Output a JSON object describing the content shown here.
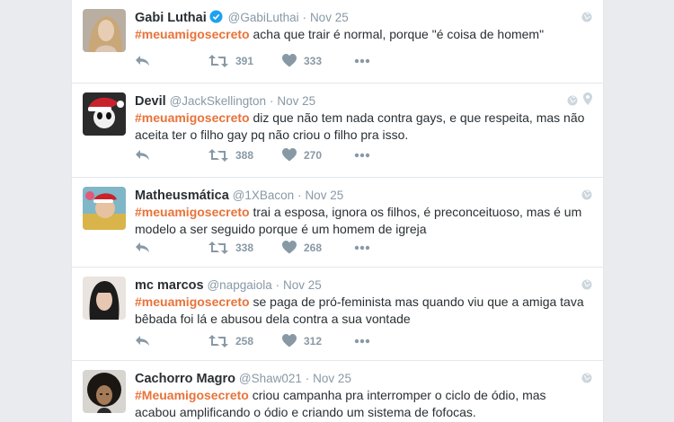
{
  "colors": {
    "hashtag": "#e8733a",
    "text": "#292f33",
    "secondary": "#8899a6",
    "verified": "#1da1f2"
  },
  "tweets": [
    {
      "name": "Gabi Luthai",
      "verified": true,
      "handle": "@GabiLuthai",
      "sep": "·",
      "date": "Nov 25",
      "hashtag": "#meuamigosecreto",
      "text": " acha que trair é normal, porque \"é coisa de homem\"",
      "retweets": "391",
      "likes": "333",
      "icons": [
        "reply-icon",
        "retweet-icon",
        "heart-icon",
        "more-icon",
        "globe-icon"
      ]
    },
    {
      "name": "Devil",
      "verified": false,
      "handle": "@JackSkellington",
      "sep": "·",
      "date": "Nov 25",
      "hashtag": "#meuamigosecreto",
      "text": " diz que não tem nada contra gays, e que respeita, mas não aceita ter o filho gay pq não criou o filho pra isso.",
      "retweets": "388",
      "likes": "270",
      "icons": [
        "reply-icon",
        "retweet-icon",
        "heart-icon",
        "more-icon",
        "globe-icon",
        "location-pin-icon"
      ]
    },
    {
      "name": "Matheusmática",
      "verified": false,
      "handle": "@1XBacon",
      "sep": "·",
      "date": "Nov 25",
      "hashtag": "#meuamigosecreto",
      "text": " trai a esposa, ignora os filhos, é preconceituoso, mas é um modelo a ser seguido porque é um homem de igreja",
      "retweets": "338",
      "likes": "268",
      "icons": [
        "reply-icon",
        "retweet-icon",
        "heart-icon",
        "more-icon",
        "globe-icon"
      ]
    },
    {
      "name": "mc marcos",
      "verified": false,
      "handle": "@napgaiola",
      "sep": "·",
      "date": "Nov 25",
      "hashtag": "#meuamigosecreto",
      "text": " se paga de pró-feminista mas quando viu que a amiga tava bêbada foi lá e abusou dela contra a sua vontade",
      "retweets": "258",
      "likes": "312",
      "icons": [
        "reply-icon",
        "retweet-icon",
        "heart-icon",
        "more-icon",
        "globe-icon"
      ]
    },
    {
      "name": "Cachorro Magro",
      "verified": false,
      "handle": "@Shaw021",
      "sep": "·",
      "date": "Nov 25",
      "hashtag": "#Meuamigosecreto",
      "text": " criou campanha pra interromper o ciclo de ódio, mas acabou amplificando o ódio e criando um sistema de fofocas.",
      "icons": [
        "globe-icon"
      ]
    }
  ]
}
